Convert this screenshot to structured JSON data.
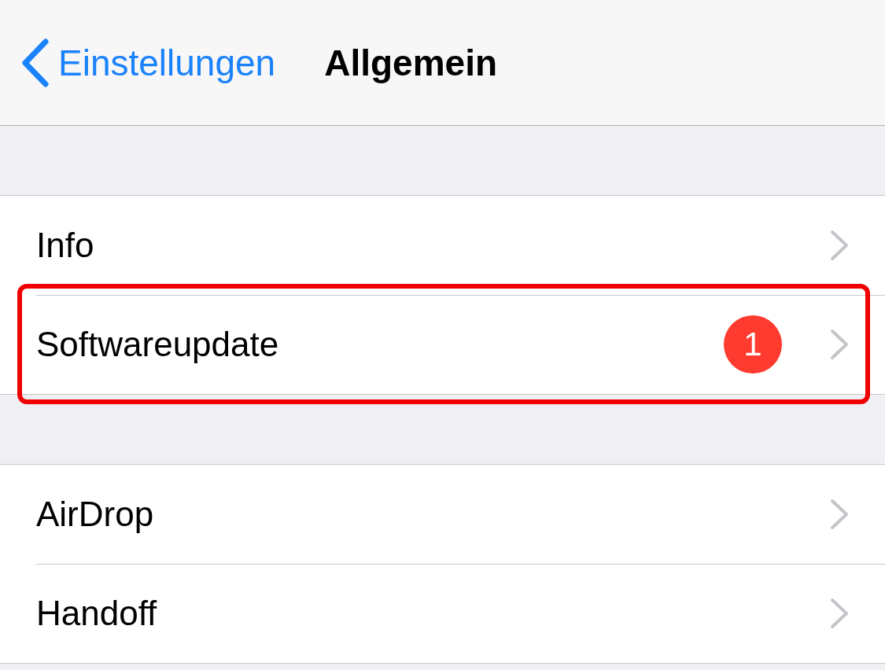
{
  "nav_bar": {
    "back_label": "Einstellungen",
    "title": "Allgemein"
  },
  "sections": [
    {
      "rows": [
        {
          "label": "Info",
          "highlighted": false
        },
        {
          "label": "Softwareupdate",
          "badge": "1",
          "highlighted": true
        }
      ]
    },
    {
      "rows": [
        {
          "label": "AirDrop",
          "highlighted": false
        },
        {
          "label": "Handoff",
          "highlighted": false
        }
      ]
    }
  ]
}
